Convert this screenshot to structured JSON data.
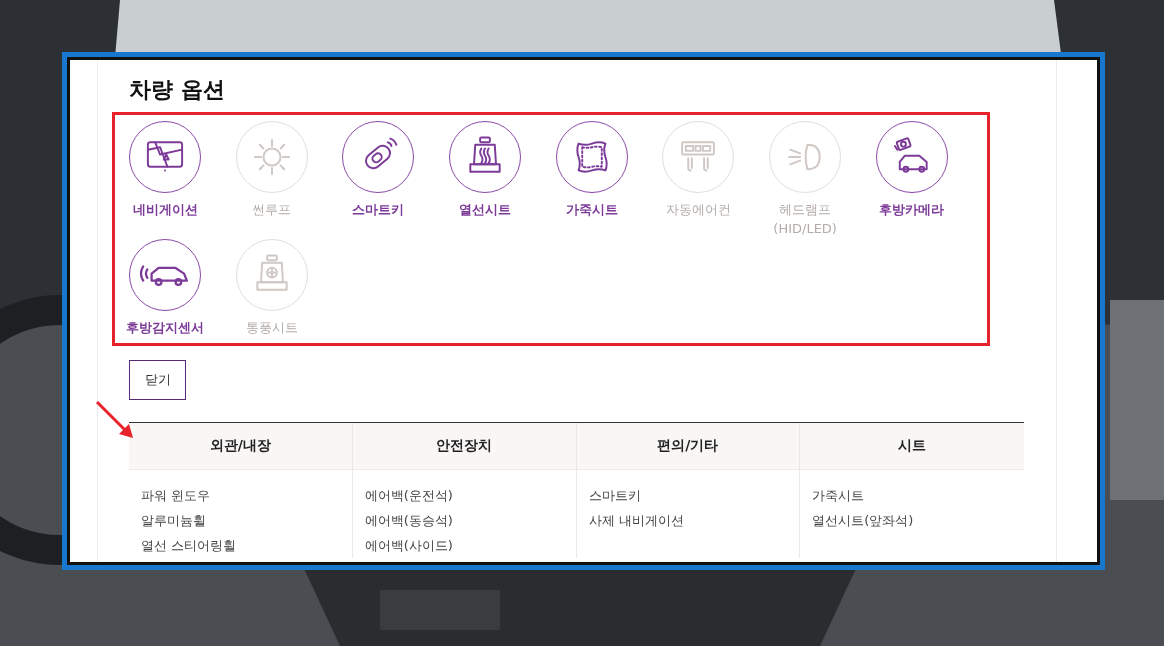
{
  "title": "차량 옵션",
  "options": [
    {
      "label": "네비게이션",
      "enabled": true
    },
    {
      "label": "썬루프",
      "enabled": false
    },
    {
      "label": "스마트키",
      "enabled": true
    },
    {
      "label": "열선시트",
      "enabled": true
    },
    {
      "label": "가죽시트",
      "enabled": true
    },
    {
      "label": "자동에어컨",
      "enabled": false
    },
    {
      "label": "헤드램프 (HID/LED)",
      "enabled": false
    },
    {
      "label": "후방카메라",
      "enabled": true
    },
    {
      "label": "후방감지센서",
      "enabled": true
    },
    {
      "label": "통풍시트",
      "enabled": false
    }
  ],
  "close_button": "닫기",
  "table": {
    "columns": [
      {
        "heading": "외관/내장",
        "items": [
          "파워 윈도우",
          "알루미늄휠",
          "열선 스티어링휠"
        ]
      },
      {
        "heading": "안전장치",
        "items": [
          "에어백(운전석)",
          "에어백(동승석)",
          "에어백(사이드)"
        ]
      },
      {
        "heading": "편의/기타",
        "items": [
          "스마트키",
          "사제 내비게이션"
        ]
      },
      {
        "heading": "시트",
        "items": [
          "가죽시트",
          "열선시트(앞좌석)"
        ]
      }
    ]
  }
}
